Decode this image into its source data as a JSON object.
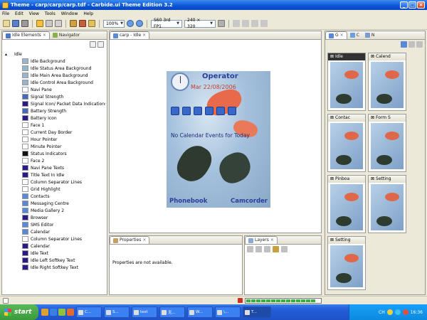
{
  "window": {
    "title": "Theme - carp/carp/carp.tdf - Carbide.ui Theme Edition 3.2",
    "min": "_",
    "max": "□",
    "close": "×"
  },
  "menu": [
    "File",
    "Edit",
    "View",
    "Tools",
    "Window",
    "Help"
  ],
  "toolbar": {
    "zoom": "100%",
    "device": "S60 3rd FP1",
    "resolution": "240 × 320"
  },
  "left_panel": {
    "tabs": [
      "Idle Elements",
      "Navigator"
    ],
    "root": "Idle",
    "items": [
      {
        "label": "Idle Background",
        "color": "#9ab4cc"
      },
      {
        "label": "Idle Status Area Background",
        "color": "#9ab4cc"
      },
      {
        "label": "Idle Main Area Background",
        "color": "#9ab4cc"
      },
      {
        "label": "Idle Control Area Background",
        "color": "#9ab4cc"
      },
      {
        "label": "Navi Pane",
        "color": "#ffffff"
      },
      {
        "label": "Signal Strength",
        "color": "#4a68b8"
      },
      {
        "label": "Signal Icon/ Packet Data Indications",
        "color": "#2a1a8a"
      },
      {
        "label": "Battery Strength",
        "color": "#4a68b8"
      },
      {
        "label": "Battery Icon",
        "color": "#2a1a8a"
      },
      {
        "label": "Face 1",
        "color": "#ffffff"
      },
      {
        "label": "Current Day Border",
        "color": "#ffffff"
      },
      {
        "label": "Hour Pointer",
        "color": "#ffffff"
      },
      {
        "label": "Minute Pointer",
        "color": "#ffffff"
      },
      {
        "label": "Status Indicators",
        "color": "#111111"
      },
      {
        "label": "Face 2",
        "color": "#ffffff"
      },
      {
        "label": "Navi Pane Texts",
        "color": "#2a1a8a"
      },
      {
        "label": "Title Text In Idle",
        "color": "#2a1a8a"
      },
      {
        "label": "Column Separator Lines",
        "color": "#ffffff"
      },
      {
        "label": "Grid Highlight",
        "color": "#ffffff"
      },
      {
        "label": "Contacts",
        "color": "#5a88d8"
      },
      {
        "label": "Messaging Centre",
        "color": "#5a88d8"
      },
      {
        "label": "Media Gallery 2",
        "color": "#5a88d8"
      },
      {
        "label": "Browser",
        "color": "#2a1a8a"
      },
      {
        "label": "SMS Editor",
        "color": "#5a88d8"
      },
      {
        "label": "Calendar",
        "color": "#5a88d8"
      },
      {
        "label": "Column Separator Lines",
        "color": "#ffffff"
      },
      {
        "label": "Calendar",
        "color": "#2a1a8a"
      },
      {
        "label": "Idle Text",
        "color": "#2a1a8a"
      },
      {
        "label": "Idle Left Softkey Text",
        "color": "#2a1a8a"
      },
      {
        "label": "Idle Right Softkey Text",
        "color": "#2a1a8a"
      }
    ]
  },
  "editor": {
    "tab": "carp - Idle",
    "phone": {
      "operator": "Operator",
      "date": "Mar 22/08/2006",
      "no_events": "No Calendar Events for Today",
      "left_softkey": "Phonebook",
      "right_softkey": "Camcorder"
    }
  },
  "bottom_left": {
    "tab": "Properties",
    "message": "Properties are not available."
  },
  "bottom_right": {
    "tab": "Layers"
  },
  "right_panel": {
    "tabs": [
      "G",
      "C",
      "N"
    ],
    "cells": [
      {
        "label": "Idle",
        "dark": true
      },
      {
        "label": "Calend",
        "dark": false
      },
      {
        "label": "Contac",
        "dark": false
      },
      {
        "label": "Form S",
        "dark": false
      },
      {
        "label": "Pinboa",
        "dark": false
      },
      {
        "label": "Setting",
        "dark": false
      },
      {
        "label": "Setting",
        "dark": false
      }
    ]
  },
  "taskbar": {
    "start": "start",
    "tasks": [
      "C...",
      "S...",
      "test",
      "无...",
      "W...",
      "\\...",
      "T..."
    ],
    "clock": "16:36",
    "tray_text": "CH"
  }
}
